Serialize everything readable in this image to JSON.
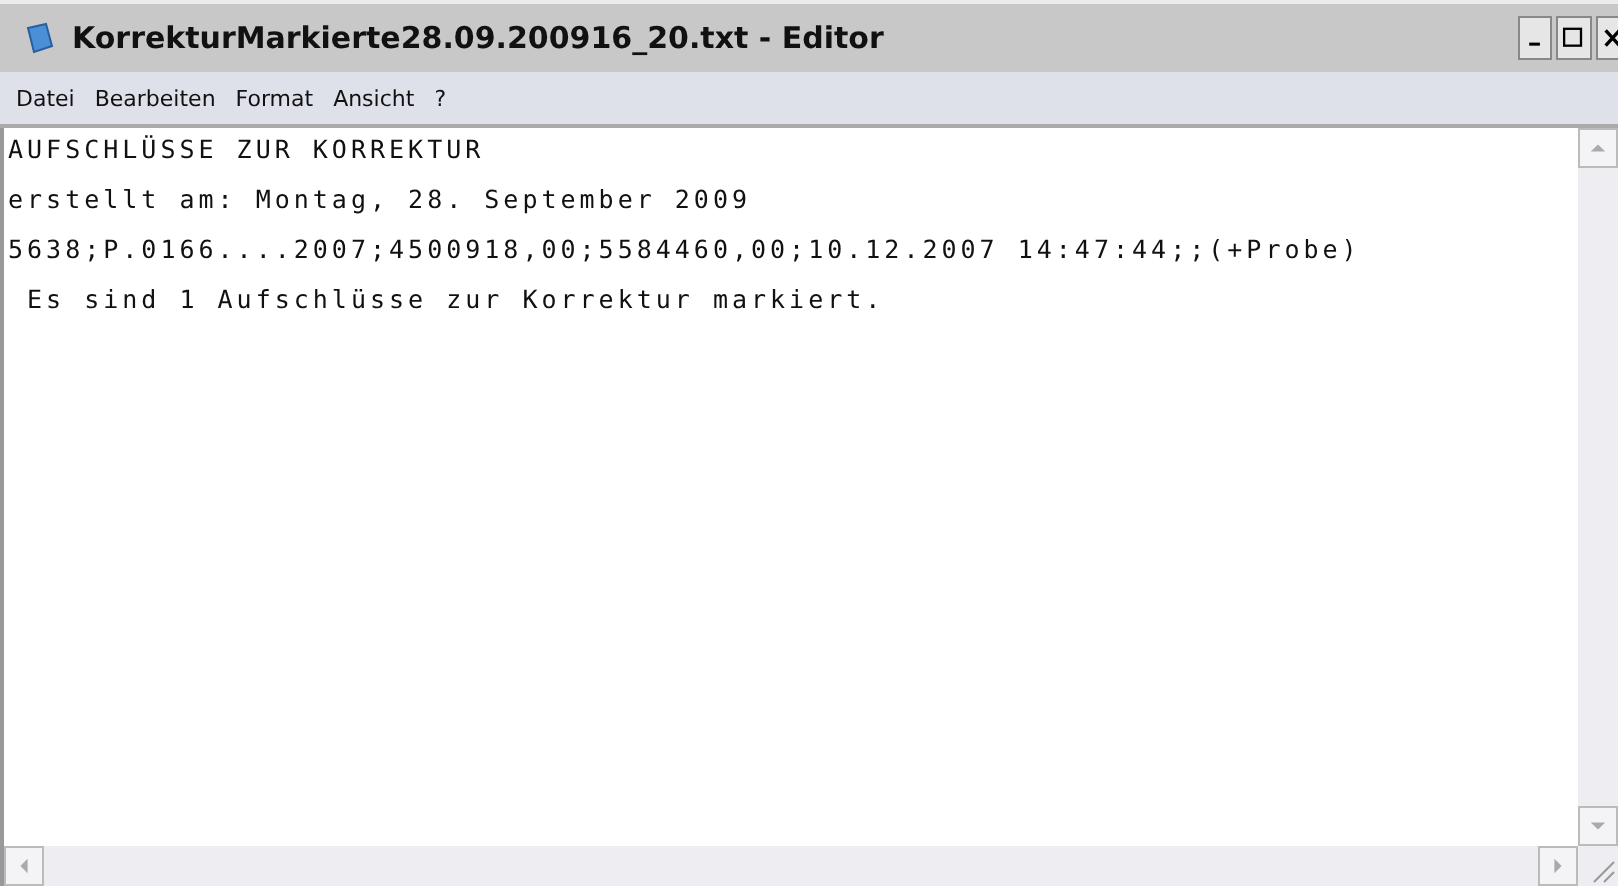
{
  "window": {
    "title": "KorrekturMarkierte28.09.200916_20.txt - Editor"
  },
  "menu": [
    "Datei",
    "Bearbeiten",
    "Format",
    "Ansicht",
    "?"
  ],
  "document": {
    "lines": [
      "AUFSCHLÜSSE ZUR KORREKTUR",
      "erstellt am: Montag, 28. September 2009",
      "5638;P.0166....2007;4500918,00;5584460,00;10.12.2007 14:47:44;;(+Probe)",
      " Es sind 1 Aufschlüsse zur Korrektur markiert."
    ]
  }
}
